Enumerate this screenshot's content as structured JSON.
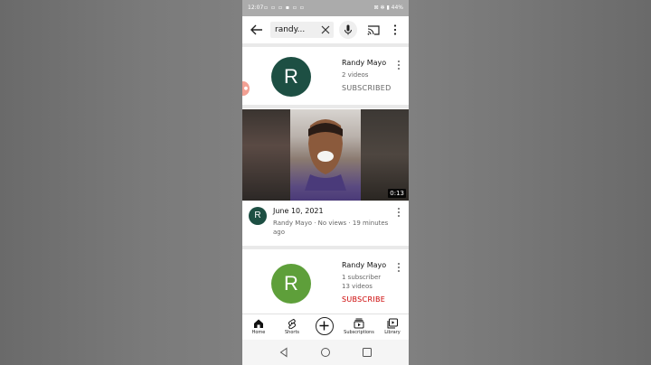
{
  "status_bar": {
    "time": "12:07",
    "icons": "▫ ▫ ▫ ▪ ▫ ▫",
    "right": "⊠ ✻ ▮ 44%"
  },
  "search": {
    "query": "randy...",
    "back_icon": "arrow-left-icon",
    "clear_icon": "close-icon",
    "mic_icon": "mic-icon",
    "cast_icon": "cast-icon",
    "more_icon": "more-vert-icon"
  },
  "channels": [
    {
      "avatar_letter": "R",
      "avatar_color": "#1d4f43",
      "name": "Randy Mayo",
      "meta1": "2 videos",
      "meta2": "",
      "action": "SUBSCRIBED"
    },
    {
      "avatar_letter": "R",
      "avatar_color": "#5e9f3a",
      "name": "Randy Mayo",
      "meta1": "1 subscriber",
      "meta2": "13 videos",
      "action": "SUBSCRIBE"
    }
  ],
  "video": {
    "duration": "0:13",
    "title": "June 10, 2021",
    "meta": "Randy Mayo · No views · 19 minutes ago",
    "avatar_letter": "R"
  },
  "nav": [
    {
      "label": "Home",
      "icon": "home-icon"
    },
    {
      "label": "Shorts",
      "icon": "shorts-icon"
    },
    {
      "label": "",
      "icon": "create-icon"
    },
    {
      "label": "Subscriptions",
      "icon": "subscriptions-icon"
    },
    {
      "label": "Library",
      "icon": "library-icon"
    }
  ],
  "colors": {
    "subscribe_red": "#cc0000",
    "avatar_dark_green": "#1d4f43",
    "avatar_light_green": "#5e9f3a"
  }
}
